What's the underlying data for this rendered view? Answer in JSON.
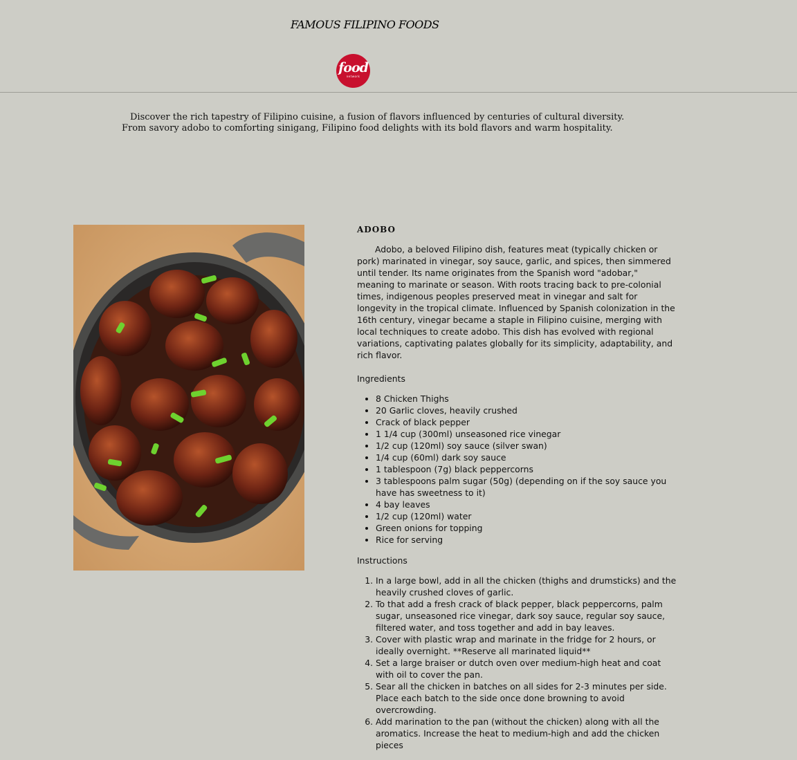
{
  "header": {
    "site_title": "FAMOUS FILIPINO FOODS",
    "logo": {
      "word": "food",
      "sub": "network",
      "color": "#c8102e"
    }
  },
  "intro": {
    "line1": "Discover the rich tapestry of Filipino cuisine, a fusion of flavors influenced by centuries of cultural diversity.",
    "line2": "From savory adobo to comforting sinigang, Filipino food delights with its bold flavors and warm hospitality."
  },
  "recipe": {
    "title": "ADOBO",
    "image": "adobo-chicken-pot-photo",
    "description": "Adobo, a beloved Filipino dish, features meat (typically chicken or pork) marinated in vinegar, soy sauce, garlic, and spices, then simmered until tender. Its name originates from the Spanish word \"adobar,\" meaning to marinate or season. With roots tracing back to pre-colonial times, indigenous peoples preserved meat in vinegar and salt for longevity in the tropical climate. Influenced by Spanish colonization in the 16th century, vinegar became a staple in Filipino cuisine, merging with local techniques to create adobo. This dish has evolved with regional variations, captivating palates globally for its simplicity, adaptability, and rich flavor.",
    "ingredients_label": "Ingredients",
    "ingredients": [
      "8 Chicken Thighs",
      "20 Garlic cloves, heavily crushed",
      "Crack of black pepper",
      "1 1/4 cup (300ml) unseasoned rice vinegar",
      "1/2 cup (120ml) soy sauce (silver swan)",
      "1/4 cup (60ml) dark soy sauce",
      "1 tablespoon (7g) black peppercorns",
      "3 tablespoons palm sugar (50g) (depending on if the soy sauce you have has sweetness to it)",
      "4 bay leaves",
      "1/2 cup (120ml) water",
      "Green onions for topping",
      "Rice for serving"
    ],
    "instructions_label": "Instructions",
    "instructions": [
      "In a large bowl, add in all the chicken (thighs and drumsticks) and the heavily crushed cloves of garlic.",
      "To that add a fresh crack of black pepper, black peppercorns, palm sugar, unseasoned rice vinegar, dark soy sauce, regular soy sauce, filtered water, and toss together and add in bay leaves.",
      "Cover with plastic wrap and marinate in the fridge for 2 hours, or ideally overnight. **Reserve all marinated liquid**",
      "Set a large braiser or dutch oven over medium-high heat and coat with oil to cover the pan.",
      "Sear all the chicken in batches on all sides for 2-3 minutes per side. Place each batch to the side once done browning to avoid overcrowding.",
      "Add marination to the pan (without the chicken) along with all the aromatics. Increase the heat to medium-high and add the chicken pieces"
    ]
  }
}
